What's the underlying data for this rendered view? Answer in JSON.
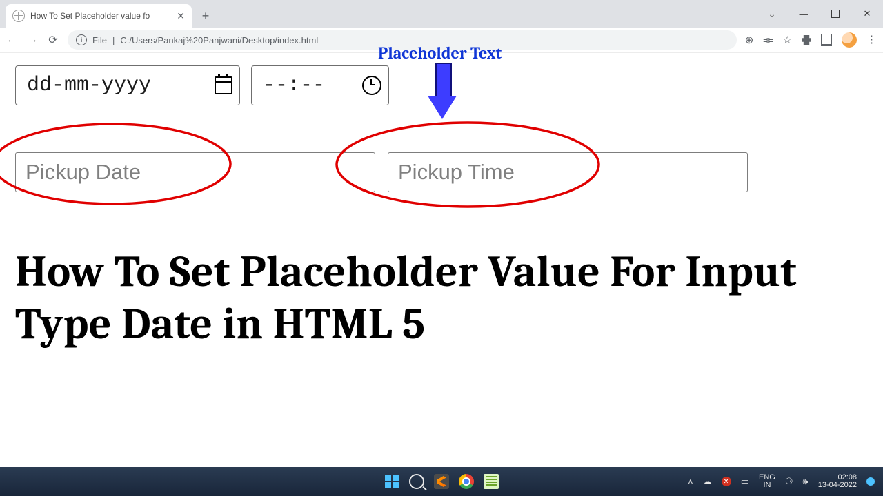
{
  "browser": {
    "tab_title": "How To Set Placeholder value fo",
    "url_scheme": "File",
    "url_path": "C:/Users/Pankaj%20Panjwani/Desktop/index.html"
  },
  "inputs": {
    "date_native": "dd-mm-yyyy",
    "time_native": "--:--",
    "pickup_date_placeholder": "Pickup Date",
    "pickup_time_placeholder": "Pickup Time"
  },
  "annotation": {
    "label": "Placeholder Text"
  },
  "heading": "How To Set Placeholder Value For Input Type Date in HTML 5",
  "taskbar": {
    "lang_top": "ENG",
    "lang_bottom": "IN",
    "time": "02:08",
    "date": "13-04-2022"
  }
}
